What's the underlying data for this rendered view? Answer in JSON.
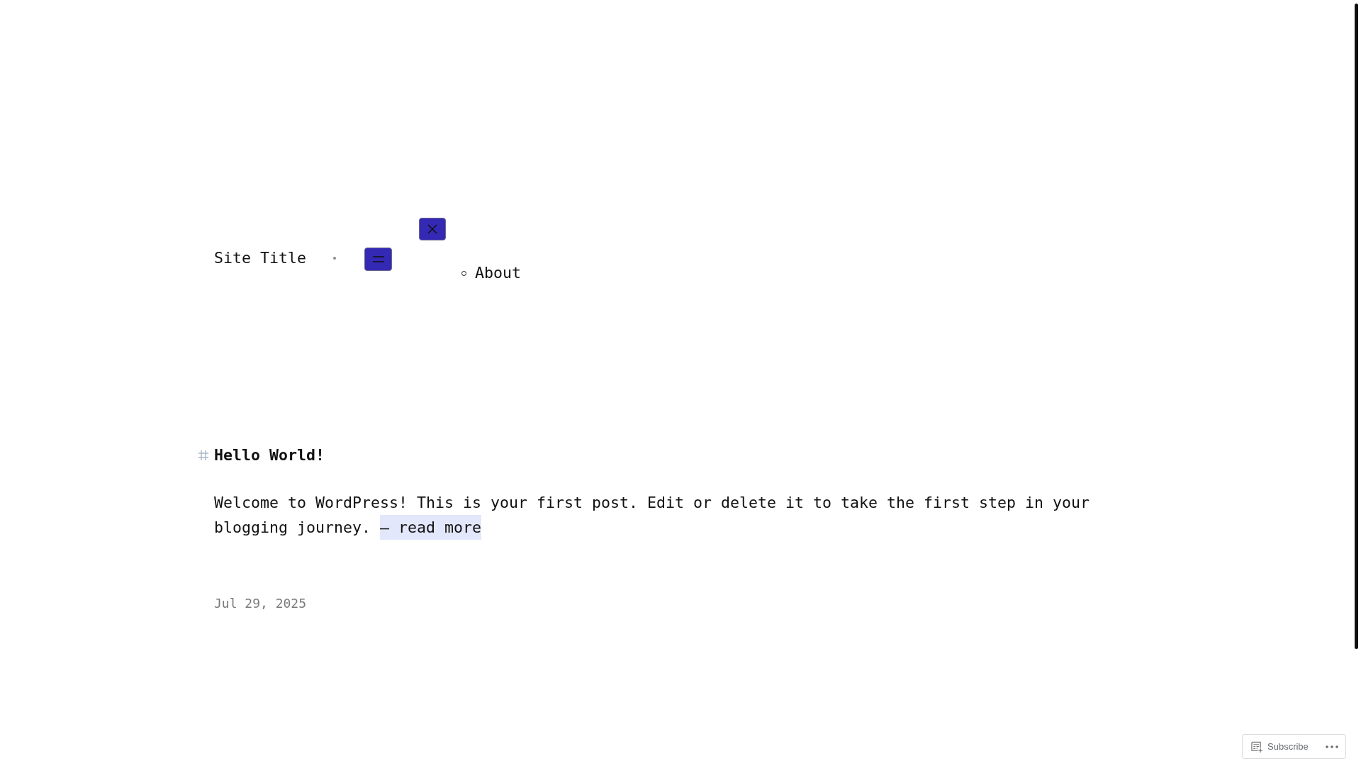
{
  "header": {
    "site_title": "Site Title",
    "nav_items": [
      {
        "label": "About"
      }
    ]
  },
  "posts": [
    {
      "title": "Hello World!",
      "excerpt": "Welcome to WordPress! This is your first post. Edit or delete it to take the first step in your blogging journey.",
      "read_more": "— read more",
      "date": "Jul 29, 2025"
    }
  ],
  "action_bar": {
    "subscribe": "Subscribe"
  }
}
